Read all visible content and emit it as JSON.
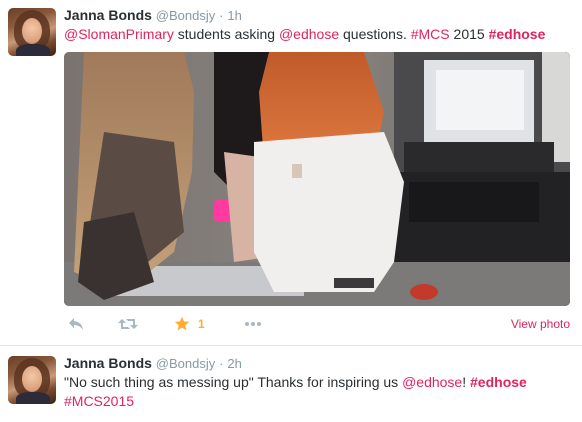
{
  "tweets": [
    {
      "name": "Janna Bonds",
      "handle": "@Bondsjy",
      "separator": "·",
      "time": "1h",
      "text_parts": {
        "mention1": "@SlomanPrimary",
        "middle": " students asking ",
        "mention2": "@edhose",
        "after": " questions. ",
        "tag1": "#MCS",
        "year": " 2015 ",
        "tag2": "#edhose"
      },
      "actions": {
        "reply_icon": "reply-icon",
        "retweet_icon": "retweet-icon",
        "favorite_icon": "star-icon",
        "favorite_count": "1",
        "more_icon": "more-icon",
        "view_photo": "View photo"
      }
    },
    {
      "name": "Janna Bonds",
      "handle": "@Bondsjy",
      "separator": "·",
      "time": "2h",
      "text_parts": {
        "line1_start": "\"No such thing as messing up\" Thanks for inspiring us ",
        "mention": "@edhose",
        "excl": "!  ",
        "tag1": "#edhose",
        "tag2": "#MCS2015"
      }
    }
  ],
  "colors": {
    "accent": "#e0245e",
    "muted": "#8899a6",
    "icon": "#aab8c2",
    "favorite": "#ffac33"
  }
}
